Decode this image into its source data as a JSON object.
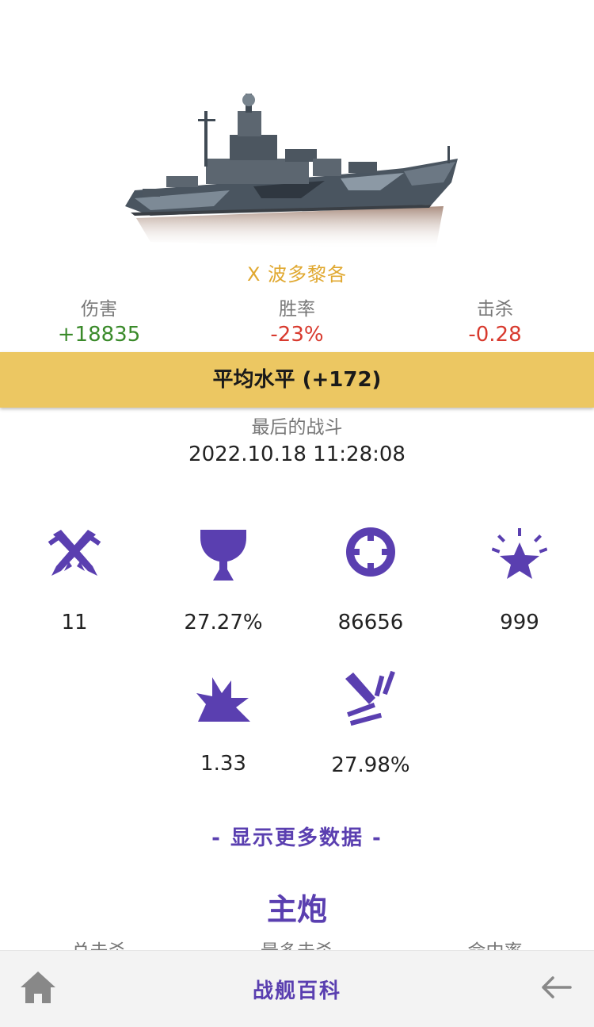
{
  "ship": {
    "name": "X 波多黎各",
    "tier_color": "#e0a830"
  },
  "summary": {
    "damage": {
      "label": "伤害",
      "value": "+18835"
    },
    "winrate": {
      "label": "胜率",
      "value": "-23%"
    },
    "kills": {
      "label": "击杀",
      "value": "-0.28"
    }
  },
  "rating_banner": "平均水平 (+172)",
  "last_battle": {
    "label": "最后的战斗",
    "value": "2022.10.18 11:28:08"
  },
  "metrics": [
    {
      "icon": "crossed-swords-icon",
      "value": "11"
    },
    {
      "icon": "trophy-icon",
      "value": "27.27%"
    },
    {
      "icon": "lifebuoy-icon",
      "value": "86656"
    },
    {
      "icon": "star-burst-icon",
      "value": "999"
    },
    {
      "icon": "explosion-icon",
      "value": "1.33"
    },
    {
      "icon": "shell-hit-icon",
      "value": "27.98%"
    }
  ],
  "show_more": "- 显示更多数据 -",
  "section": {
    "title": "主炮",
    "labels": [
      "总击杀",
      "最多击杀",
      "命中率"
    ]
  },
  "tabbar": {
    "title": "战舰百科",
    "home_icon": "home-icon",
    "back_icon": "back-arrow-icon"
  },
  "colors": {
    "accent": "#5a3fb0",
    "banner": "#ecc762",
    "positive": "#3a8a2a",
    "negative": "#d83a2e"
  }
}
